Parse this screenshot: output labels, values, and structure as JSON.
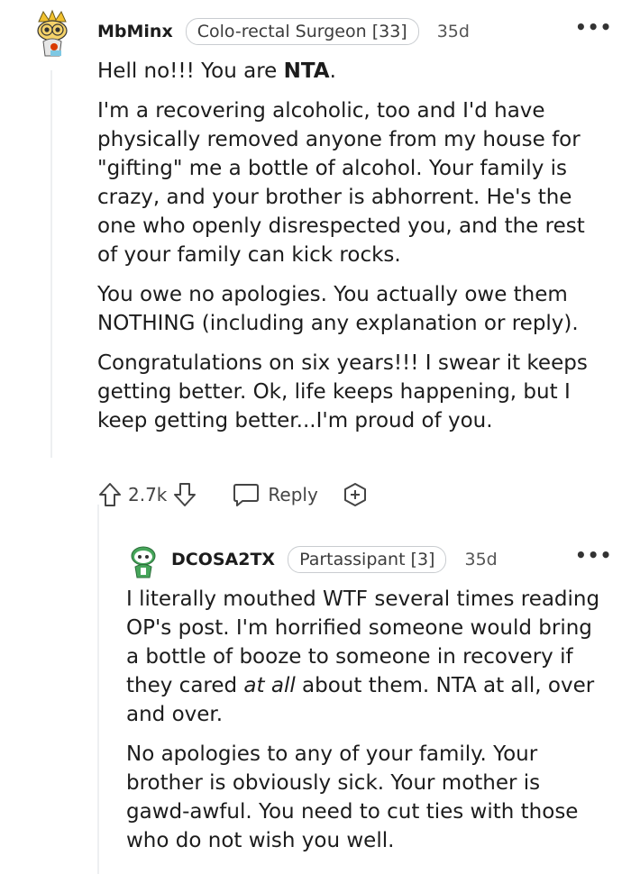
{
  "comment": {
    "username": "MbMinx",
    "flair": "Colo-rectal Surgeon [33]",
    "time": "35d",
    "para1_text": "Hell no!!! You are ",
    "para1_bold": "NTA",
    "para1_end": ".",
    "para2": "I'm a recovering alcoholic, too and I'd have physically removed anyone from my house for \"gifting\" me a bottle of alcohol. Your family is crazy, and your brother is abhorrent. He's the one who openly disrespected you, and the rest of your family can kick rocks.",
    "para3": "You owe no apologies. You actually owe them NOTHING (including any explanation or reply).",
    "para4": "Congratulations on six years!!! I swear it keeps getting better. Ok, life keeps happening, but I keep getting better...I'm proud of you.",
    "vote_count": "2.7k",
    "reply_label": "Reply"
  },
  "reply": {
    "username": "DCOSA2TX",
    "flair": "Partassipant [3]",
    "time": "35d",
    "para1_a": "I literally mouthed WTF several times reading OP's post. I'm horrified someone would bring a bottle of booze to someone in recovery if they cared ",
    "para1_em": "at all",
    "para1_b": " about them. NTA at all, over and over.",
    "para2": "No apologies to any of your family. Your brother is obviously sick. Your mother is gawd-awful. You need to cut ties with those who do not wish you well."
  },
  "icons": {
    "more": "more-options-icon",
    "upvote": "upvote-arrow-icon",
    "downvote": "downvote-arrow-icon",
    "reply": "speech-bubble-icon",
    "award": "plus-award-icon"
  }
}
